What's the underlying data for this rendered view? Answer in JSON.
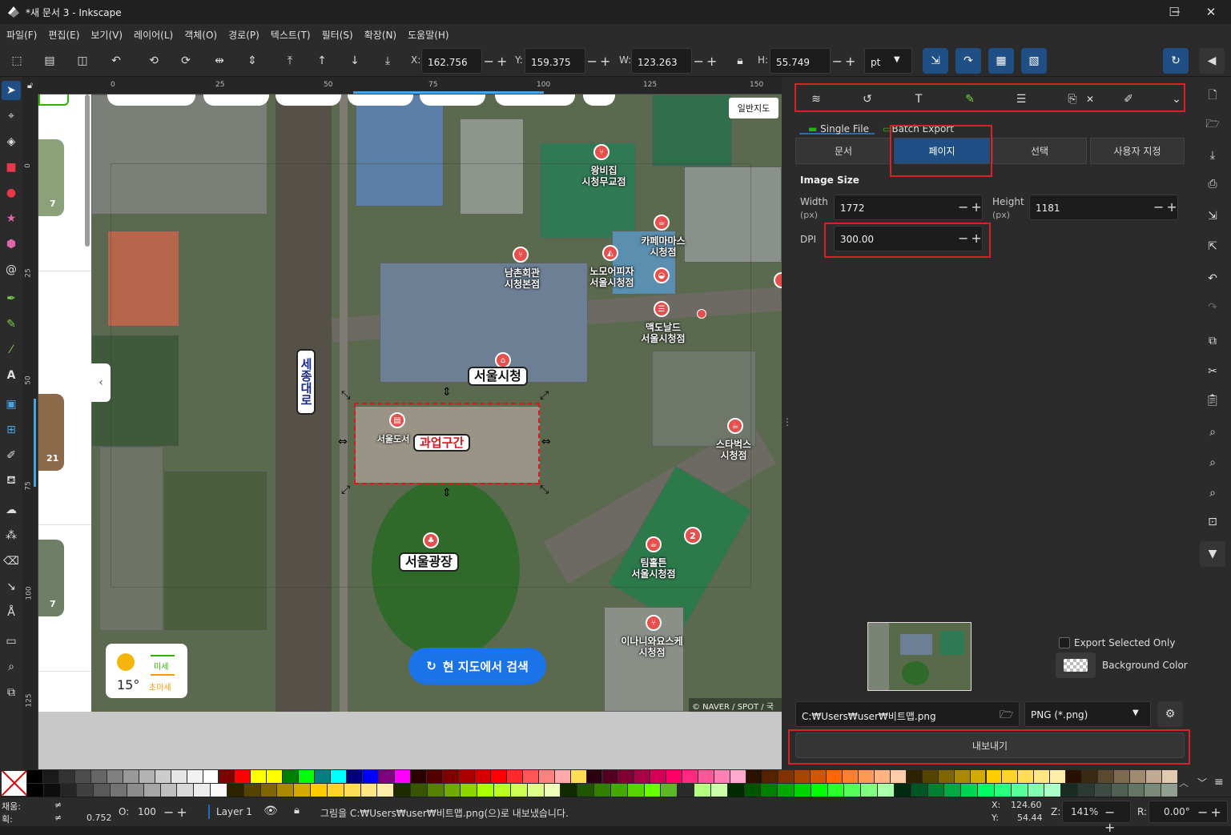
{
  "window": {
    "title": "*새 문서 3 - Inkscape",
    "min": "─",
    "max": "☐",
    "close": "✕"
  },
  "menu": [
    "파일(F)",
    "편집(E)",
    "보기(V)",
    "레이어(L)",
    "객체(O)",
    "경로(P)",
    "텍스트(T)",
    "필터(S)",
    "확장(N)",
    "도움말(H)"
  ],
  "toolbar": {
    "x_label": "X:",
    "x_value": "162.756",
    "y_label": "Y:",
    "y_value": "159.375",
    "w_label": "W:",
    "w_value": "123.263",
    "h_label": "H:",
    "h_value": "55.749",
    "unit": "pt"
  },
  "ruler": {
    "h_ticks": [
      "0",
      "25",
      "50",
      "75",
      "100",
      "125",
      "150"
    ],
    "v_ticks": [
      "0",
      "25",
      "50",
      "75",
      "100",
      "125"
    ]
  },
  "map": {
    "labels": {
      "city_hall": "서울시청",
      "plaza": "서울광장",
      "sejong": "세종대로",
      "work_zone": "과업구간",
      "library": "서울도서",
      "research_btn": "현 지도에서 검색",
      "map_type": "일반지도",
      "copyright": "© NAVER / SPOT / 국"
    },
    "pois": [
      {
        "name": "왕비집\n시청무교점"
      },
      {
        "name": "카페마마스\n시청점"
      },
      {
        "name": "남촌회관\n시청본점"
      },
      {
        "name": "노모어피자\n서울시청점"
      },
      {
        "name": "맥도날드\n서울시청점"
      },
      {
        "name": "스타벅스\n시청점"
      },
      {
        "name": "팀홀튼\n서울시청점"
      },
      {
        "name": "이나니와요스케\n시청점"
      }
    ],
    "weather": {
      "temp": "15°",
      "dust": "미세",
      "fine_dust": "초미세"
    },
    "side_thumbs": [
      "7",
      "21",
      "7"
    ],
    "badge": "2"
  },
  "export_panel": {
    "tab_single": "Single File",
    "tab_batch": "Batch Export",
    "seg_document": "문서",
    "seg_page": "페이지",
    "seg_selection": "선택",
    "seg_custom": "사용자 지정",
    "image_size": "Image Size",
    "width_label": "Width",
    "width_unit": "(px)",
    "width_value": "1772",
    "height_label": "Height",
    "height_unit": "(px)",
    "height_value": "1181",
    "dpi_label": "DPI",
    "dpi_value": "300.00",
    "export_selected_only": "Export Selected Only",
    "background_color": "Background Color",
    "filename": "C:₩Users₩user₩비트맵.png",
    "format": "PNG (*.png)",
    "export_button": "내보내기"
  },
  "status": {
    "fill_label": "채움:",
    "stroke_label": "획:",
    "fill_value": "≠",
    "stroke_value": "≠",
    "stroke_width": "0.752",
    "opacity_label": "O:",
    "opacity_value": "100",
    "layer": "Layer 1",
    "message": "그림을 C:₩Users₩user₩비트맵.png(으)로 내보냈습니다.",
    "cx_label": "X:",
    "cx": "124.60",
    "cy_label": "Y:",
    "cy": "54.44",
    "zoom_label": "Z:",
    "zoom": "141%",
    "rot_label": "R:",
    "rotation": "0.00°"
  },
  "colors": {
    "accent": "#1f4f84",
    "highlight": "#d8222a",
    "dashed": "#e0161e"
  }
}
